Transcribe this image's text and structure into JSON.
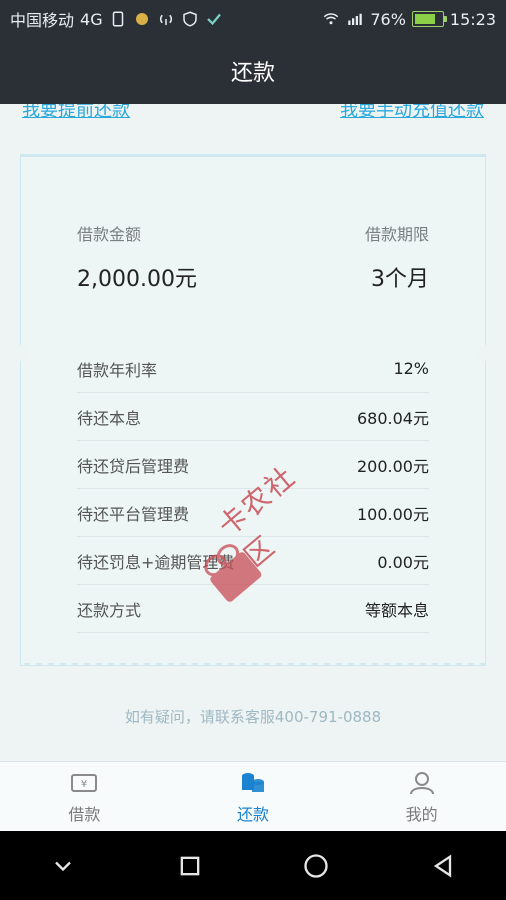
{
  "status_bar": {
    "carrier": "中国移动",
    "network": "4G",
    "signal_label": "4G",
    "battery_percent": "76%",
    "time": "15:23"
  },
  "nav": {
    "title": "还款"
  },
  "top_links": {
    "prepay": "我要提前还款",
    "manual_recharge": "我要手动充值还款"
  },
  "card": {
    "loan_amount_label": "借款金额",
    "loan_amount_value": "2,000.00元",
    "loan_term_label": "借款期限",
    "loan_term_value": "3个月",
    "items": [
      {
        "label": "借款年利率",
        "value": "12%"
      },
      {
        "label": "待还本息",
        "value": "680.04元"
      },
      {
        "label": "待还贷后管理费",
        "value": "200.00元"
      },
      {
        "label": "待还平台管理费",
        "value": "100.00元"
      },
      {
        "label": "待还罚息+逾期管理费",
        "value": "0.00元"
      },
      {
        "label": "还款方式",
        "value": "等额本息"
      }
    ]
  },
  "help_text": "如有疑问，请联系客服400-791-0888",
  "watermark": {
    "text": "卡农社区"
  },
  "tabs": [
    {
      "label": "借款",
      "icon": "wallet-icon"
    },
    {
      "label": "还款",
      "icon": "coins-icon"
    },
    {
      "label": "我的",
      "icon": "user-icon"
    }
  ],
  "colors": {
    "accent": "#1b83cf",
    "link": "#2aa8dc",
    "dark": "#2b2f36"
  }
}
